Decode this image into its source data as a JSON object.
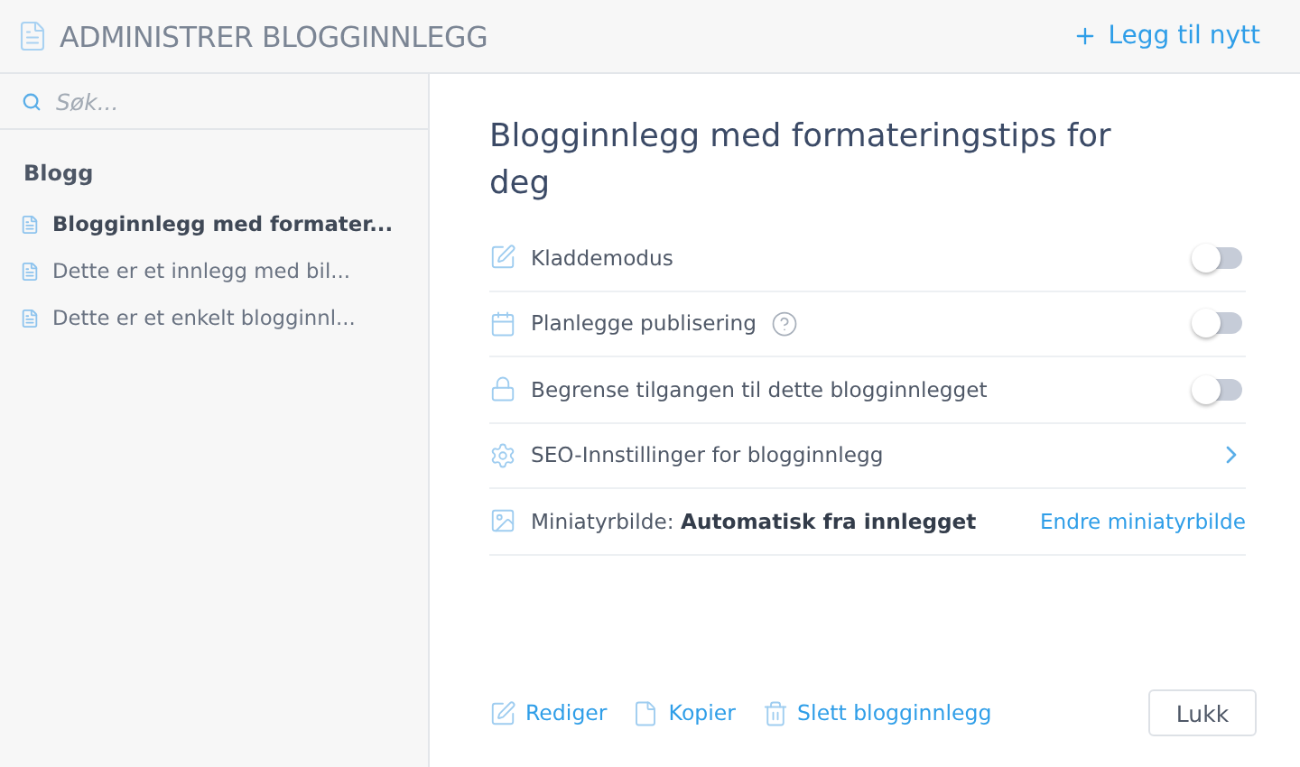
{
  "header": {
    "title": "ADMINISTRER BLOGGINNLEGG",
    "add_button": "Legg til nytt"
  },
  "sidebar": {
    "search": {
      "placeholder": "Søk..."
    },
    "section": "Blogg",
    "items": [
      {
        "label": "Blogginnlegg med formater...",
        "selected": true
      },
      {
        "label": "Dette er et innlegg med bil...",
        "selected": false
      },
      {
        "label": "Dette er et enkelt blogginnl...",
        "selected": false
      }
    ]
  },
  "post": {
    "title": "Blogginnlegg med formateringstips for deg",
    "settings": [
      {
        "kind": "toggle",
        "label": "Kladdemodus",
        "help": false,
        "on": false
      },
      {
        "kind": "toggle",
        "label": "Planlegge publisering",
        "help": true,
        "on": false
      },
      {
        "kind": "toggle",
        "label": "Begrense tilgangen til dette blogginnlegget",
        "help": false,
        "on": false
      },
      {
        "kind": "link",
        "label": "SEO-Innstillinger for blogginnlegg"
      },
      {
        "kind": "value",
        "label": "Miniatyrbilde: **Automatisk fra innlegget**",
        "action": "Endre miniatyrbilde"
      }
    ]
  },
  "footer": {
    "actions": [
      {
        "label": "Rediger"
      },
      {
        "label": "Kopier"
      },
      {
        "label": "Slett blogginnlegg"
      }
    ],
    "close": "Lukk"
  }
}
